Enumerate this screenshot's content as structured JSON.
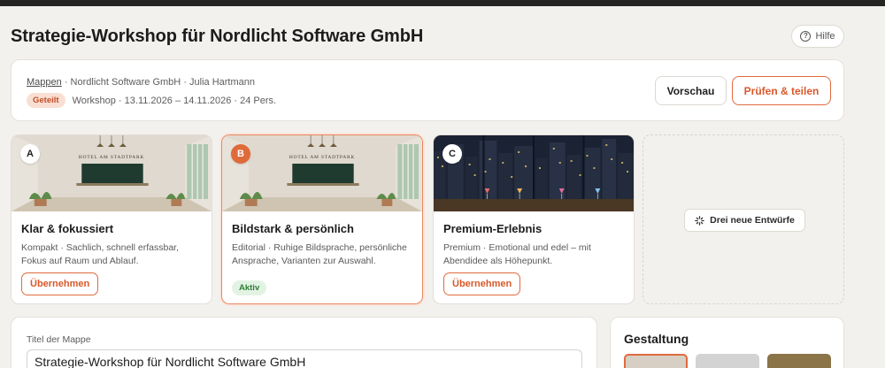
{
  "page": {
    "title": "Strategie-Workshop für Nordlicht Software GmbH",
    "help_label": "Hilfe"
  },
  "header": {
    "breadcrumb_link": "Mappen",
    "breadcrumb_rest": " · Nordlicht Software GmbH · Julia Hartmann",
    "status_badge": "Geteilt",
    "meta": "Workshop · 13.11.2026 – 14.11.2026 · 24 Pers.",
    "preview_label": "Vorschau",
    "share_label": "Prüfen & teilen"
  },
  "variants": [
    {
      "letter": "A",
      "title": "Klar & fokussiert",
      "description": "Kompakt · Sachlich, schnell erfassbar, Fokus auf Raum und Ablauf.",
      "action_label": "Übernehmen",
      "thumb_caption": "HOTEL AM STADTPARK"
    },
    {
      "letter": "B",
      "title": "Bildstark & persönlich",
      "description": "Editorial · Ruhige Bildsprache, persönliche Ansprache, Varianten zur Auswahl.",
      "status_label": "Aktiv",
      "thumb_caption": "HOTEL AM STADTPARK"
    },
    {
      "letter": "C",
      "title": "Premium-Erlebnis",
      "description": "Premium · Emotional und edel – mit Abendidee als Höhepunkt.",
      "action_label": "Übernehmen"
    }
  ],
  "new_drafts": {
    "label": "Drei neue Entwürfe"
  },
  "title_field": {
    "label": "Titel der Mappe",
    "value": "Strategie-Workshop für Nordlicht Software GmbH"
  },
  "design": {
    "title": "Gestaltung",
    "swatches": [
      "#d7cfc4",
      "#d3d3d3",
      "#8a7448"
    ]
  },
  "colors": {
    "accent": "#df6a3a",
    "active_green": "#2f7d35"
  }
}
